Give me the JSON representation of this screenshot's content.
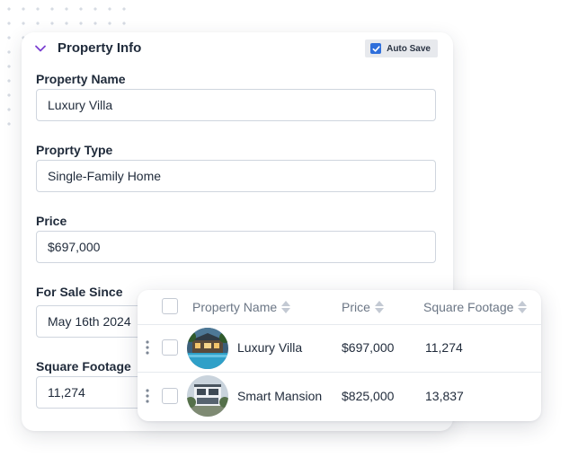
{
  "form": {
    "title": "Property Info",
    "autosave_label": "Auto Save",
    "autosave_checked": true,
    "fields": [
      {
        "label": "Property Name",
        "value": "Luxury Villa"
      },
      {
        "label": "Proprty Type",
        "value": "Single-Family Home"
      },
      {
        "label": "Price",
        "value": "$697,000"
      },
      {
        "label": "For Sale Since",
        "value": "May 16th 2024"
      },
      {
        "label": "Square Footage",
        "value": "11,274"
      }
    ]
  },
  "table": {
    "columns": [
      "Property Name",
      "Price",
      "Square Footage"
    ],
    "rows": [
      {
        "name": "Luxury Villa",
        "price": "$697,000",
        "sqft": "11,274",
        "thumb": "villa-photo"
      },
      {
        "name": "Smart Mansion",
        "price": "$825,000",
        "sqft": "13,837",
        "thumb": "mansion-photo"
      }
    ]
  },
  "colors": {
    "accent": "#2f6fdb",
    "chevron": "#7a3fd1",
    "text": "#1f2a3a",
    "muted": "#6b7685"
  }
}
